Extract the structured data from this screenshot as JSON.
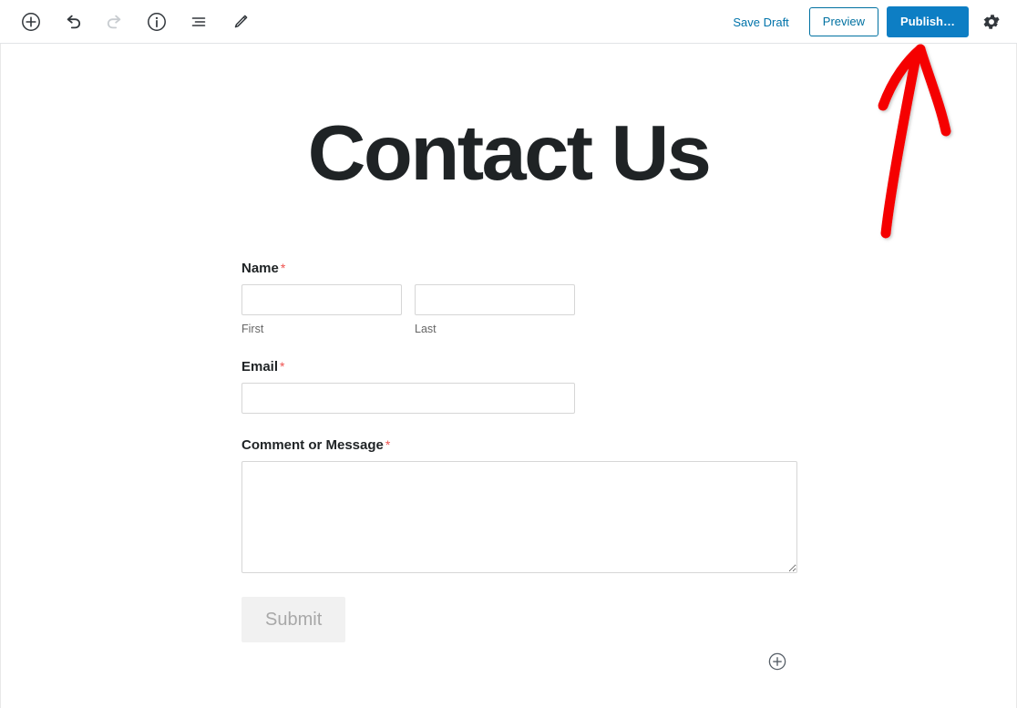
{
  "toolbar": {
    "left_icons": [
      {
        "name": "add-block-icon",
        "label": "Add block"
      },
      {
        "name": "undo-icon",
        "label": "Undo"
      },
      {
        "name": "redo-icon",
        "label": "Redo"
      },
      {
        "name": "info-icon",
        "label": "Content structure"
      },
      {
        "name": "list-view-icon",
        "label": "List view"
      },
      {
        "name": "edit-pencil-icon",
        "label": "Edit"
      }
    ],
    "save_draft_label": "Save Draft",
    "preview_label": "Preview",
    "publish_label": "Publish…",
    "settings_icon": "gear-icon"
  },
  "page": {
    "title": "Contact Us"
  },
  "form": {
    "name": {
      "label": "Name",
      "required_marker": "*",
      "first": {
        "value": "",
        "placeholder": "",
        "sub_label": "First"
      },
      "last": {
        "value": "",
        "placeholder": "",
        "sub_label": "Last"
      }
    },
    "email": {
      "label": "Email",
      "required_marker": "*",
      "value": "",
      "placeholder": ""
    },
    "message": {
      "label": "Comment or Message",
      "required_marker": "*",
      "value": "",
      "placeholder": ""
    },
    "submit_label": "Submit"
  },
  "appender": {
    "icon": "add-block-icon"
  },
  "annotation": {
    "type": "hand-drawn-arrow",
    "points_at": "publish-button",
    "color": "#f50000"
  },
  "colors": {
    "wp_blue": "#0073aa",
    "publish_blue": "#0d7ec4",
    "required_red": "#ef5350",
    "annotation_red": "#f50000",
    "border_gray": "#d6d6d6",
    "toolbar_border": "#e2e4e7",
    "submit_bg": "#f1f1f1",
    "submit_text": "#a8a8a8"
  }
}
